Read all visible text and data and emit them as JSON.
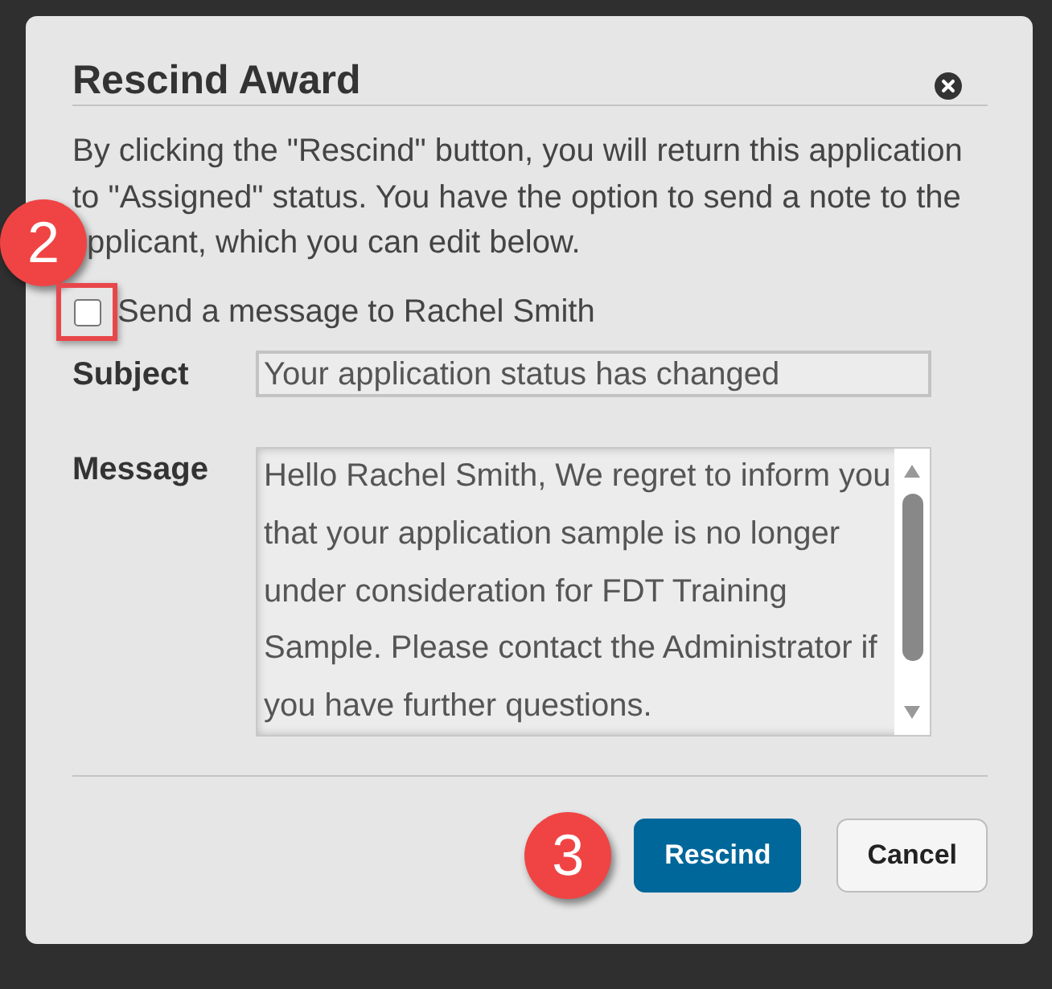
{
  "dialog": {
    "title": "Rescind Award"
  },
  "description": "By clicking the \"Rescind\" button, you will return this application to \"Assigned\" status. You have the option to send a note to the pplicant, which you can edit below.",
  "send_message": {
    "label": "Send a message to Rachel Smith",
    "checked": false,
    "highlighted": true,
    "callout": "2"
  },
  "fields": [
    {
      "kind": "line",
      "label": "Subject",
      "value": "Your application status has changed",
      "disabled": true
    },
    {
      "kind": "area",
      "label": "Message",
      "value": "Hello Rachel Smith, We regret to inform you that your application sample is no longer under consideration for FDT Training Sample. Please contact the Administrator if you have further questions.",
      "disabled": true
    }
  ],
  "buttons": [
    {
      "kind": "primary",
      "label": "Rescind",
      "callout": "3"
    },
    {
      "kind": "secondary",
      "label": "Cancel"
    }
  ]
}
